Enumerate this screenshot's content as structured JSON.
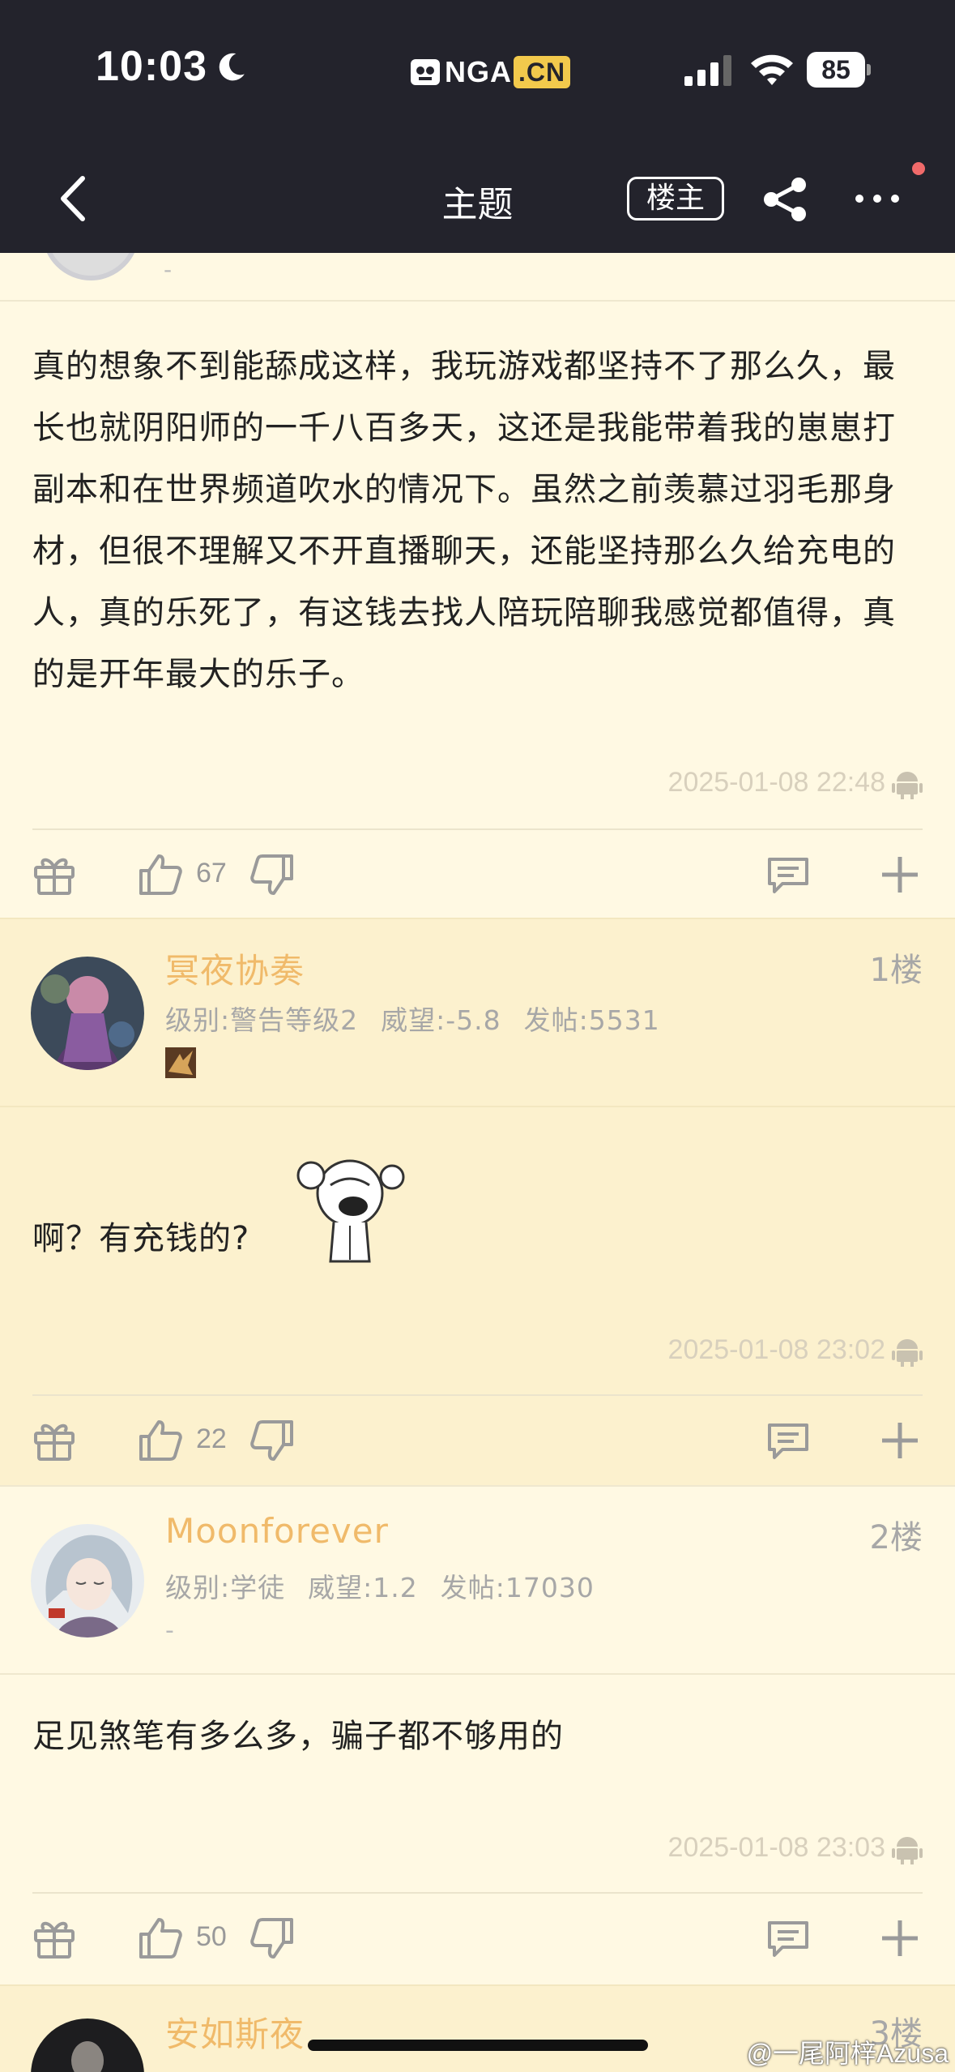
{
  "status_bar": {
    "time": "10:03",
    "logo_text": "NGA",
    "logo_suffix": ".CN",
    "battery": "85"
  },
  "nav": {
    "title": "主题",
    "op_button": "楼主"
  },
  "posts": [
    {
      "text": "真的想象不到能舔成这样，我玩游戏都坚持不了那么久，最长也就阴阳师的一千八百多天，这还是我能带着我的崽崽打副本和在世界频道吹水的情况下。虽然之前羡慕过羽毛那身材，但很不理解又不开直播聊天，还能坚持那么久给充电的人，真的乐死了，有这钱去找人陪玩陪聊我感觉都值得，真的是开年最大的乐子。",
      "time": "2025-01-08 22:48",
      "likes": "67"
    },
    {
      "user": "冥夜协奏",
      "floor": "1楼",
      "level": "级别:警告等级2",
      "prestige": "威望:-5.8",
      "posts_count": "发帖:5531",
      "text": "啊？有充钱的?",
      "time": "2025-01-08 23:02",
      "likes": "22"
    },
    {
      "user": "Moonforever",
      "floor": "2楼",
      "level": "级别:学徒",
      "prestige": "威望:1.2",
      "posts_count": "发帖:17030",
      "sig": "-",
      "text": "足见煞笔有多么多，骗子都不够用的",
      "time": "2025-01-08 23:03",
      "likes": "50"
    },
    {
      "user": "安如斯夜",
      "floor": "3楼"
    }
  ],
  "partial_sig": "-",
  "watermark": "@一尾阿梓Azusa",
  "colors": {
    "topbar": "#23232c",
    "background": "#fff9e3",
    "reply_header": "#fcf1ce",
    "username": "#f0ba6a"
  }
}
